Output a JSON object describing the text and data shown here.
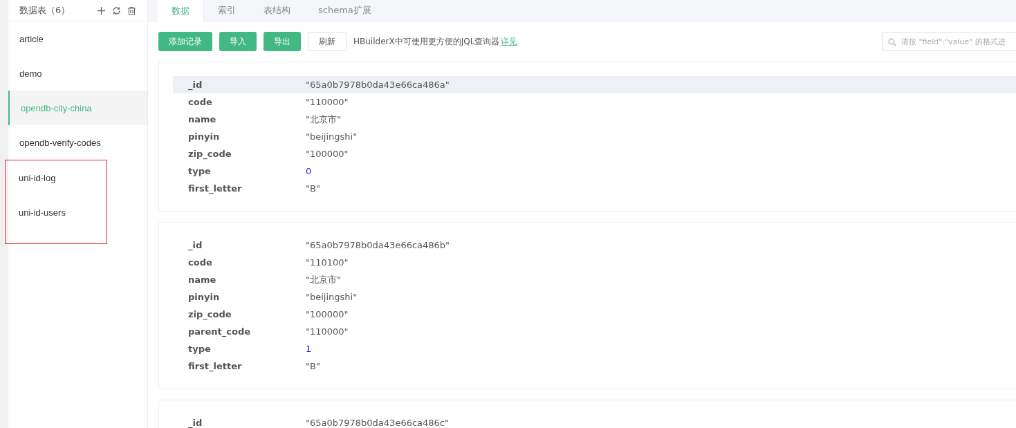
{
  "sidebar": {
    "title": "数据表（6）",
    "items": [
      {
        "label": "article",
        "selected": false,
        "annotated": false
      },
      {
        "label": "demo",
        "selected": false,
        "annotated": false
      },
      {
        "label": "opendb-city-china",
        "selected": true,
        "annotated": false
      },
      {
        "label": "opendb-verify-codes",
        "selected": false,
        "annotated": false
      },
      {
        "label": "uni-id-log",
        "selected": false,
        "annotated": true
      },
      {
        "label": "uni-id-users",
        "selected": false,
        "annotated": true
      }
    ]
  },
  "tabs": [
    {
      "label": "数据",
      "selected": true
    },
    {
      "label": "索引",
      "selected": false
    },
    {
      "label": "表结构",
      "selected": false
    },
    {
      "label": "schema扩展",
      "selected": false
    }
  ],
  "toolbar": {
    "buttons": [
      {
        "label": "添加记录",
        "kind": "primary"
      },
      {
        "label": "导入",
        "kind": "primary"
      },
      {
        "label": "导出",
        "kind": "primary"
      },
      {
        "label": "刷新",
        "kind": "plain"
      }
    ],
    "hint": "HBuilderX中可使用更方便的JQL查询器",
    "hint_link": "详见",
    "search": {
      "placeholder": "请按 \"field\":\"value\" 的格式进"
    }
  },
  "records": [
    {
      "fields": [
        {
          "key": "_id",
          "value": "\"65a0b7978b0da43e66ca486a\"",
          "kind": "string",
          "hovered": true
        },
        {
          "key": "code",
          "value": "\"110000\"",
          "kind": "string",
          "hovered": false
        },
        {
          "key": "name",
          "value": "\"北京市\"",
          "kind": "string",
          "hovered": false
        },
        {
          "key": "pinyin",
          "value": "\"beijingshi\"",
          "kind": "string",
          "hovered": false
        },
        {
          "key": "zip_code",
          "value": "\"100000\"",
          "kind": "string",
          "hovered": false
        },
        {
          "key": "type",
          "value": "0",
          "kind": "number",
          "hovered": false
        },
        {
          "key": "first_letter",
          "value": "\"B\"",
          "kind": "string",
          "hovered": false
        }
      ]
    },
    {
      "fields": [
        {
          "key": "_id",
          "value": "\"65a0b7978b0da43e66ca486b\"",
          "kind": "string",
          "hovered": false
        },
        {
          "key": "code",
          "value": "\"110100\"",
          "kind": "string",
          "hovered": false
        },
        {
          "key": "name",
          "value": "\"北京市\"",
          "kind": "string",
          "hovered": false
        },
        {
          "key": "pinyin",
          "value": "\"beijingshi\"",
          "kind": "string",
          "hovered": false
        },
        {
          "key": "zip_code",
          "value": "\"100000\"",
          "kind": "string",
          "hovered": false
        },
        {
          "key": "parent_code",
          "value": "\"110000\"",
          "kind": "string",
          "hovered": false
        },
        {
          "key": "type",
          "value": "1",
          "kind": "number",
          "hovered": false
        },
        {
          "key": "first_letter",
          "value": "\"B\"",
          "kind": "string",
          "hovered": false
        }
      ]
    },
    {
      "fields": [
        {
          "key": "_id",
          "value": "\"65a0b7978b0da43e66ca486c\"",
          "kind": "string",
          "hovered": false
        }
      ]
    }
  ]
}
